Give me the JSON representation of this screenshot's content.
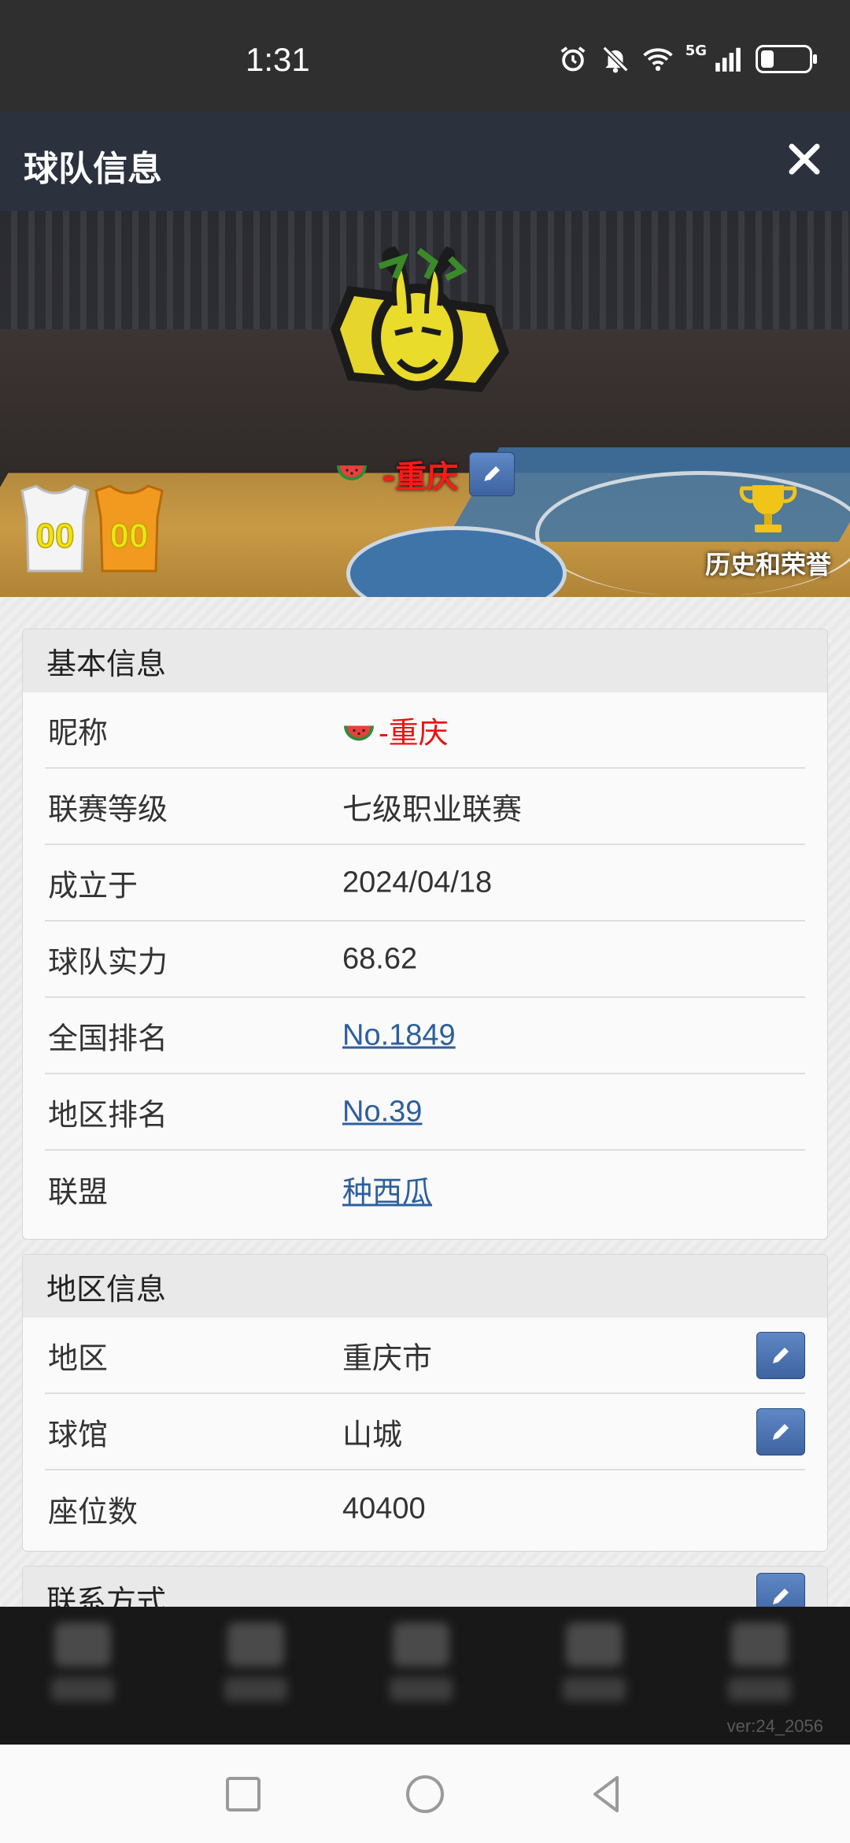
{
  "status_bar": {
    "time": "1:31",
    "network": "5G",
    "icons": [
      "alarm-icon",
      "bell-muted-icon",
      "wifi-icon",
      "signal-icon",
      "battery-icon"
    ]
  },
  "header": {
    "title": "球队信息",
    "close_icon": "close-icon"
  },
  "banner": {
    "team_name": "-重庆",
    "team_emoji": "watermelon-icon",
    "jerseys": [
      "00",
      "00"
    ],
    "honor_label": "历史和荣誉",
    "colors": {
      "home_jersey": "#f4f4f4",
      "away_jersey": "#f29a1f",
      "team_name": "#ff1a1a"
    }
  },
  "basic_info": {
    "title": "基本信息",
    "rows": [
      {
        "label": "昵称",
        "value": "-重庆"
      },
      {
        "label": "联赛等级",
        "value": "七级职业联赛"
      },
      {
        "label": "成立于",
        "value": "2024/04/18"
      },
      {
        "label": "球队实力",
        "value": "68.62"
      },
      {
        "label": "全国排名",
        "value": "No.1849"
      },
      {
        "label": "地区排名",
        "value": "No.39"
      },
      {
        "label": "联盟",
        "value": "种西瓜"
      }
    ]
  },
  "region_info": {
    "title": "地区信息",
    "rows": [
      {
        "label": "地区",
        "value": "重庆市"
      },
      {
        "label": "球馆",
        "value": "山城"
      },
      {
        "label": "座位数",
        "value": "40400"
      }
    ]
  },
  "contact": {
    "title": "联系方式"
  },
  "footer": {
    "version": "ver:24_2056"
  },
  "colors": {
    "header_bg": "#2b313d",
    "link": "#2d5f9e",
    "edit_button": "#4a70b0"
  }
}
